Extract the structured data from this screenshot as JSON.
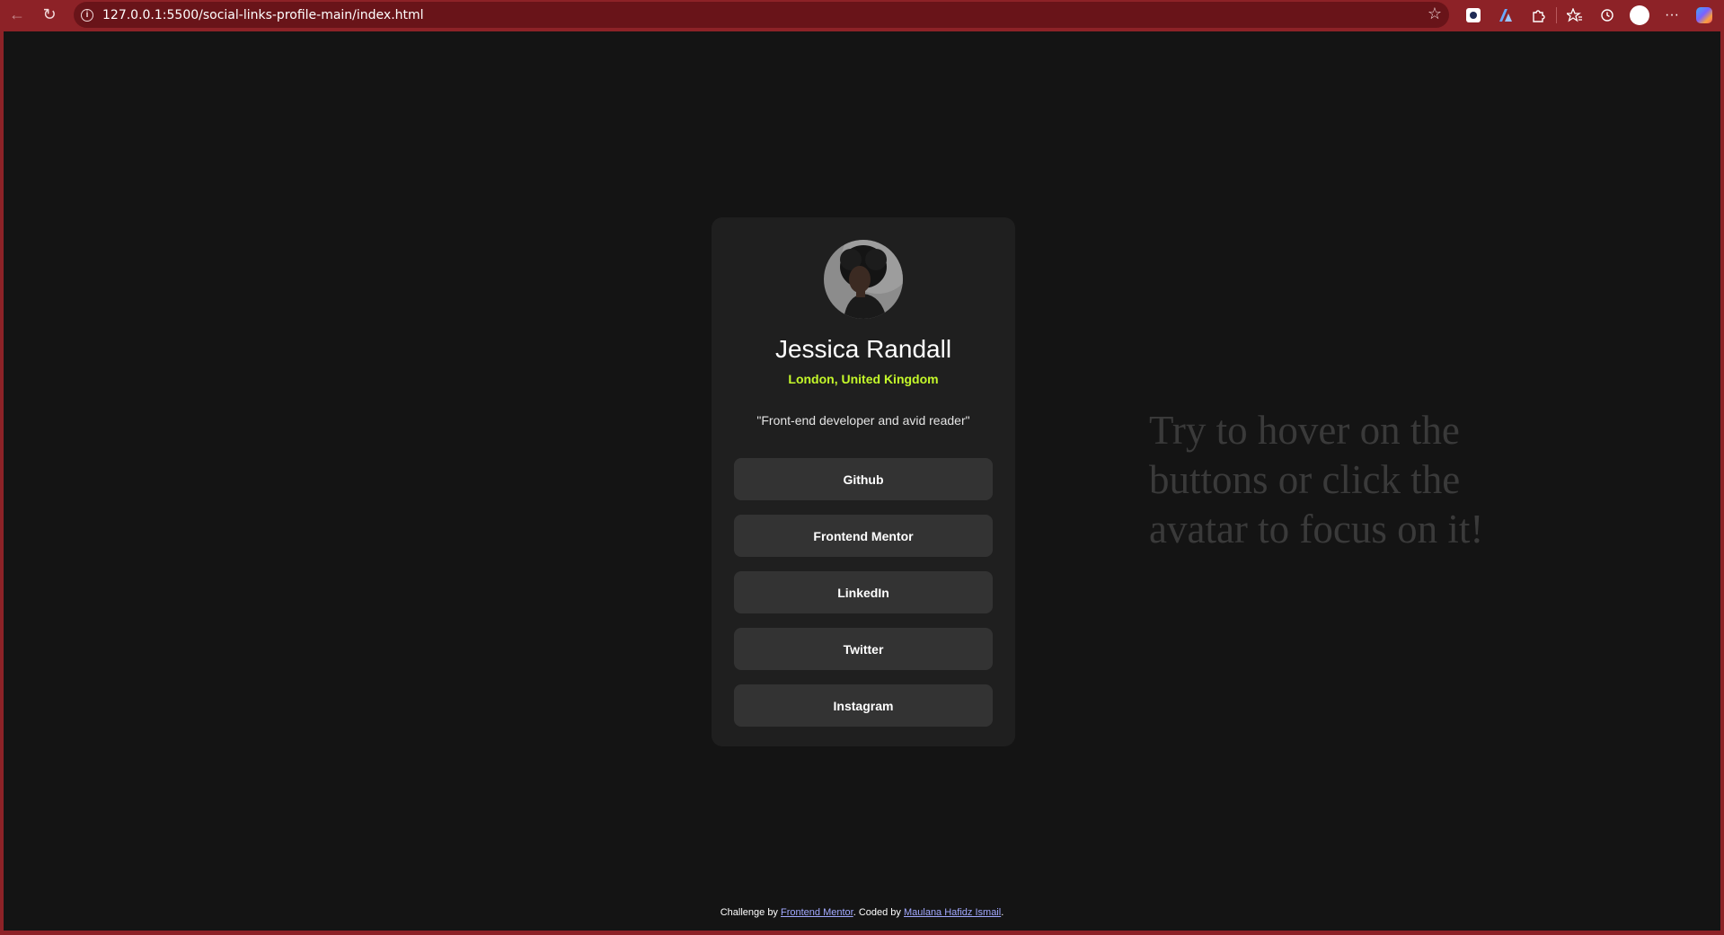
{
  "browser": {
    "url": "127.0.0.1:5500/social-links-profile-main/index.html",
    "icons": [
      "back-arrow-icon",
      "reload-icon",
      "info-icon",
      "star-icon",
      "extension-shield-icon",
      "extension-a-icon",
      "puzzle-icon",
      "favorites-icon",
      "history-icon",
      "profile-icon",
      "more-icon",
      "copilot-icon"
    ],
    "more_label": "···"
  },
  "profile": {
    "name": "Jessica Randall",
    "location": "London, United Kingdom",
    "bio": "\"Front-end developer and avid reader\"",
    "links": [
      {
        "label": "Github"
      },
      {
        "label": "Frontend Mentor"
      },
      {
        "label": "LinkedIn"
      },
      {
        "label": "Twitter"
      },
      {
        "label": "Instagram"
      }
    ]
  },
  "hint": {
    "text": "Try to hover on the buttons or click the avatar to focus on it!"
  },
  "attribution": {
    "prefix": "Challenge by ",
    "challenge_link": "Frontend Mentor",
    "middle": ". Coded by ",
    "author_link": "Maulana Hafidz Ismail",
    "suffix": "."
  },
  "colors": {
    "frame": "#8d2227",
    "page_bg": "#141414",
    "card_bg": "#1f1f1f",
    "button_bg": "#333333",
    "accent_green": "#c4f82a",
    "link_blue": "#a2a9ff"
  }
}
